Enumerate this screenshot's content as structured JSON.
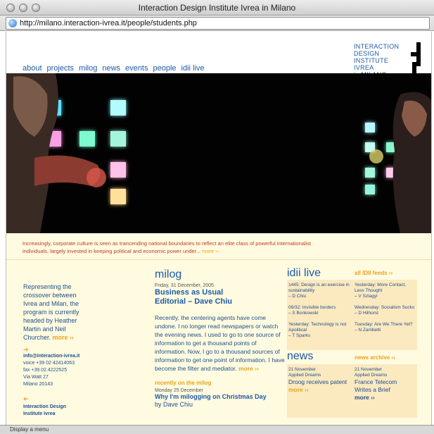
{
  "window": {
    "title": "Interaction Design Institute Ivrea in Milano"
  },
  "address": {
    "url": "http://milano.interaction-ivrea.it/people/students.php"
  },
  "nav": [
    "about",
    "projects",
    "milog",
    "news",
    "events",
    "people",
    "idii live"
  ],
  "logo": {
    "lines": [
      "INTERACTION",
      "DESIGN",
      "INSTITUTE",
      "IVREA"
    ],
    "city": "in MILANO"
  },
  "hero": {
    "caption": "Increasingly, corporate culture is seen as trancending national boundaries to reflect an elite class of powerful internationalist individuals, largely invested in keeping political and economic power under...",
    "more": "more ››"
  },
  "intro": {
    "text": "Representing the crossover between Ivrea and Milan, the program is currently headed by Heather Martin and Neil Churcher.",
    "more": "more ››"
  },
  "contact": {
    "arrow": "➔",
    "email": "info@interaction-ivrea.it",
    "voice": "voice +39 02 42414063",
    "fax": "fax +39.02.4222525",
    "street": "Via Watt 27",
    "city": "Milano 20143",
    "back_arrow": "➔",
    "org_line1": "Interaction Design",
    "org_line2": "Institute Ivrea"
  },
  "milog": {
    "title": "milog",
    "date": "Friday, 31 December, 2005",
    "post_title": "Business as Usual",
    "post_subtitle": "Editorial – Dave Chiu",
    "body": "Recently, the centering agents have come undone. I no longer read newspapers or watch the evening news. I used to go to one source of information to get a thousand points of information. Now, I go to a thousand sources of information to get one point of information. I have become the filter and mediator.",
    "more": "more ››",
    "recent_head": "recently on the milog",
    "recent_date": "Monday 25 December",
    "recent_title": "Why I'm milogging on Christmas Day",
    "recent_author": "by Dave Chiu"
  },
  "idii_live": {
    "title": "idii live",
    "feeds_label": "all IDII feeds ››",
    "left_items": [
      {
        "text": "1445: Design is an exercise in sustainability",
        "author": "– D Chiu"
      },
      {
        "text": "09/32: Invisible borders",
        "author": "– S Bonkowski"
      },
      {
        "text": "Yesterday: Technology is not Apolitical",
        "author": "– T Sparks"
      }
    ],
    "right_items": [
      {
        "text": "Yesterday: More Contact, Less Thought",
        "author": "– V Szlagyi"
      },
      {
        "text": "Wednesday: Socialism Sucks",
        "author": "– D Hilhorst"
      },
      {
        "text": "Tuesday: Are We There Yet?",
        "author": "– N Zambetti"
      }
    ]
  },
  "news": {
    "title": "news",
    "archive_label": "news archive ››",
    "items": [
      {
        "date": "21 November",
        "tag": "Applied Dreams",
        "headline": "Droog receives patent",
        "more": "more ››"
      },
      {
        "date": "21 November",
        "tag": "Applied Dreams",
        "headline": "France Telecom Writes a Brief",
        "more": "more ››"
      }
    ]
  },
  "status": {
    "text": "Display a menu"
  }
}
